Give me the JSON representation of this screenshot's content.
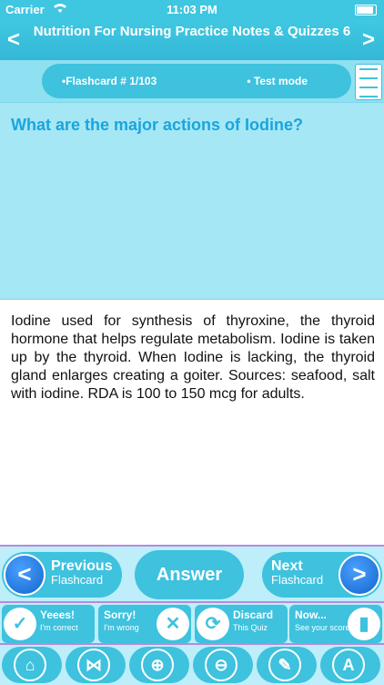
{
  "status_bar": {
    "carrier": "Carrier",
    "time": "11:03 PM"
  },
  "nav": {
    "title": "Nutrition For Nursing Practice Notes & Quizzes 6",
    "back": "<",
    "forward": ">"
  },
  "info": {
    "flashcard": "•Flashcard #  1/103",
    "mode": "• Test mode"
  },
  "question": "What are the major actions of Iodine?",
  "answer": "Iodine used for synthesis of thyroxine, the thyroid hormone that helps regulate metabolism. Iodine is taken up by the thyroid. When Iodine is lacking, the thyroid gland enlarges creating a goiter. Sources: seafood, salt with iodine. RDA is 100 to 150 mcg for adults.",
  "row1": {
    "prev": {
      "line1": "Previous",
      "line2": "Flashcard",
      "icon": "<"
    },
    "answer": "Answer",
    "next": {
      "line1": "Next",
      "line2": "Flashcard",
      "icon": ">"
    }
  },
  "row2": [
    {
      "line1": "Yeees!",
      "line2": "I'm correct",
      "icon": "✓"
    },
    {
      "line1": "Sorry!",
      "line2": "I'm wrong",
      "icon": "✕"
    },
    {
      "line1": "Discard",
      "line2": "This Quiz",
      "icon": "⟳"
    },
    {
      "line1": "Now...",
      "line2": "See your score",
      "icon": "▮"
    }
  ],
  "row3": [
    {
      "icon": "⌂"
    },
    {
      "icon": "⋈"
    },
    {
      "icon": "⊕"
    },
    {
      "icon": "⊖"
    },
    {
      "icon": "✎"
    },
    {
      "icon": "A"
    }
  ],
  "colors": {
    "accent": "#3ec2de",
    "question_text": "#1aa5dc",
    "question_bg": "#a6e7f6",
    "icon_blue": "#1366cc"
  }
}
